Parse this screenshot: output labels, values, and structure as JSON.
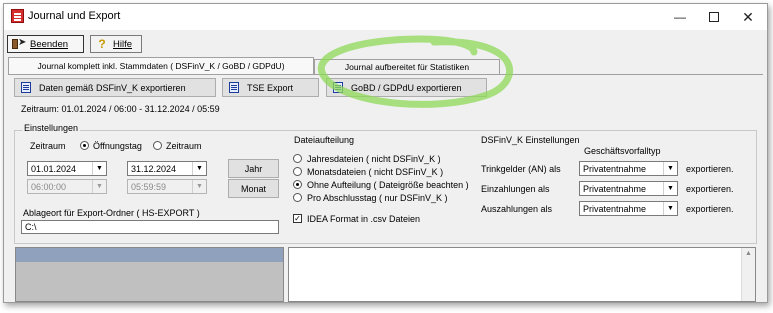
{
  "window": {
    "title": "Journal und Export"
  },
  "toolbar": {
    "exit_label": "Beenden",
    "help_label": "Hilfe"
  },
  "tabs": [
    {
      "label": "Journal komplett inkl. Stammdaten ( DSFinV_K / GoBD / GDPdU)"
    },
    {
      "label": "Journal aufbereitet für Statistiken"
    }
  ],
  "actions": {
    "export_dsfinv": "Daten gemäß DSFinV_K exportieren",
    "tse_export": "TSE Export",
    "gobd_export": "GoBD / GDPdU exportieren"
  },
  "period_text": "Zeitraum: 01.01.2024 / 06:00 - 31.12.2024 / 05:59",
  "settings": {
    "legend": "Einstellungen",
    "zeitraum_label": "Zeitraum",
    "opt_oeffnungstag": "Öffnungstag",
    "opt_zeitraum": "Zeitraum",
    "date_from": "01.01.2024",
    "date_to": "31.12.2024",
    "time_from": "06:00:00",
    "time_to": "05:59:59",
    "year_button": "Jahr",
    "month_button": "Monat",
    "export_folder_label": "Ablageort für Export-Ordner ( HS-EXPORT )",
    "export_folder_value": "C:\\"
  },
  "file_split": {
    "heading": "Dateiaufteilung",
    "options": [
      "Jahresdateien ( nicht DSFinV_K )",
      "Monatsdateien ( nicht DSFinV_K )",
      "Ohne Aufteilung ( Dateigröße beachten )",
      "Pro Abschlusstag ( nur DSFinV_K )"
    ],
    "selected_index": 2,
    "idea_label": "IDEA Format in .csv Dateien",
    "idea_checked": true
  },
  "dsfinv_settings": {
    "heading": "DSFinV_K Einstellungen",
    "column_header": "Geschäftsvorfalltyp",
    "rows": [
      {
        "label": "Trinkgelder (AN) als",
        "value": "Privatentnahme",
        "suffix": "exportieren."
      },
      {
        "label": "Einzahlungen als",
        "value": "Privatentnahme",
        "suffix": "exportieren."
      },
      {
        "label": "Auszahlungen als",
        "value": "Privatentnahme",
        "suffix": "exportieren."
      }
    ]
  },
  "colors": {
    "title_bar": "#ffffff",
    "window_bg": "#f0f0f0",
    "app_icon": "#d62d2d",
    "highlight_swirl": "#8fd95a",
    "list_header": "#8fa1bd"
  }
}
